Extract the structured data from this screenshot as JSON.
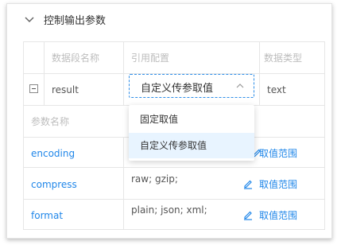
{
  "section": {
    "title": "控制输出参数"
  },
  "table": {
    "headers": {
      "field_name": "数据段名称",
      "ref_config": "引用配置",
      "data_type": "数据类型"
    },
    "main_row": {
      "name": "result",
      "ref_value": "自定义传参取值",
      "type": "text"
    },
    "param_header": "参数名称",
    "params": [
      {
        "name": "encoding",
        "value": "",
        "link": "取值范围"
      },
      {
        "name": "compress",
        "value": "raw; gzip;",
        "link": "取值范围"
      },
      {
        "name": "format",
        "value": "plain; json; xml;",
        "link": "取值范围"
      }
    ]
  },
  "dropdown": {
    "options": [
      "固定取值",
      "自定义传参取值"
    ],
    "selected": "自定义传参取值"
  },
  "colors": {
    "accent": "#1f86e9",
    "selected_bg": "#e8f4ff",
    "border": "#e6e6e6"
  }
}
